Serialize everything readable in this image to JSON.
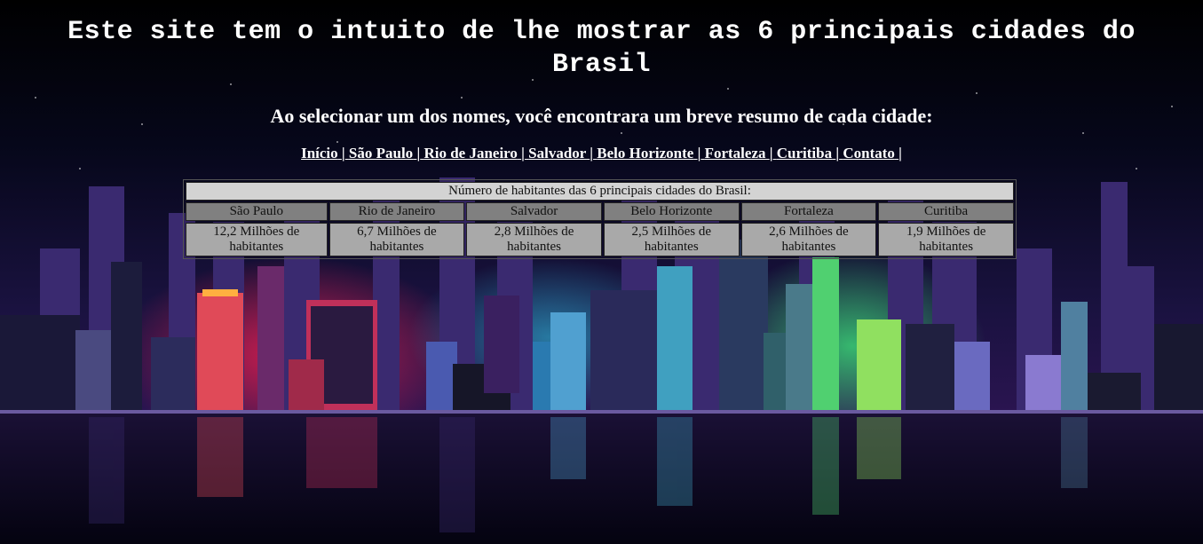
{
  "page": {
    "title": "Este site tem o intuito de lhe mostrar as 6 principais cidades do Brasil",
    "subtitle": "Ao selecionar um dos nomes, você encontrara um breve resumo de cada cidade:"
  },
  "nav": {
    "links": [
      "Início",
      "São Paulo",
      "Rio de Janeiro",
      "Salvador",
      "Belo Horizonte",
      "Fortaleza",
      "Curitiba",
      "Contato"
    ],
    "separator": "|"
  },
  "table": {
    "caption": "Número de habitantes das 6 principais cidades do Brasil:",
    "cities": [
      "São Paulo",
      "Rio de Janeiro",
      "Salvador",
      "Belo Horizonte",
      "Fortaleza",
      "Curitiba"
    ],
    "values": [
      "12,2 Milhões de habitantes",
      "6,7 Milhões de habitantes",
      "2,8 Milhões de habitantes",
      "2,5 Milhões de habitantes",
      "2,6 Milhões de habitantes",
      "1,9 Milhões de habitantes"
    ]
  },
  "colors": {
    "caption_bg": "#d3d3d3",
    "header_bg": "#808080",
    "value_bg": "#a9a9a9",
    "text": "#ffffff"
  },
  "background": {
    "icon": "neon-city-skyline-illustration"
  }
}
